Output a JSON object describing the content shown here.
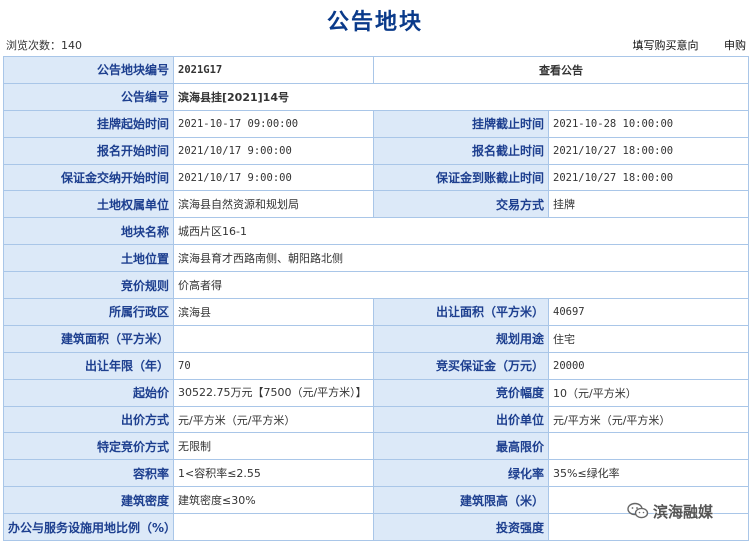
{
  "page": {
    "title": "公告地块",
    "view_count_label": "浏览次数：140",
    "links": [
      "填写购买意向",
      "申购"
    ]
  },
  "table": {
    "parcel_code_label": "公告地块编号",
    "parcel_code": "2021G17",
    "view_notice": "查看公告",
    "notice_no_label": "公告编号",
    "notice_no": "滨海县挂[2021]14号",
    "list_start_label": "挂牌起始时间",
    "list_start": "2021-10-17 09:00:00",
    "list_end_label": "挂牌截止时间",
    "list_end": "2021-10-28 10:00:00",
    "reg_start_label": "报名开始时间",
    "reg_start": "2021/10/17 9:00:00",
    "reg_end_label": "报名截止时间",
    "reg_end": "2021/10/27 18:00:00",
    "deposit_start_label": "保证金交纳开始时间",
    "deposit_start": "2021/10/17 9:00:00",
    "deposit_end_label": "保证金到账截止时间",
    "deposit_end": "2021/10/27 18:00:00",
    "owner_label": "土地权属单位",
    "owner": "滨海县自然资源和规划局",
    "trade_method_label": "交易方式",
    "trade_method": "挂牌",
    "parcel_name_label": "地块名称",
    "parcel_name": "城西片区16-1",
    "location_label": "土地位置",
    "location": "滨海县育才西路南侧、朝阳路北侧",
    "bid_rule_label": "竞价规则",
    "bid_rule": "价高者得",
    "district_label": "所属行政区",
    "district": "滨海县",
    "area_label": "出让面积（平方米）",
    "area": "40697",
    "building_area_label": "建筑面积（平方米）",
    "building_area": "",
    "use_label": "规划用途",
    "use": "住宅",
    "term_label": "出让年限（年）",
    "term": "70",
    "bid_deposit_label": "竞买保证金（万元）",
    "bid_deposit": "20000",
    "start_price_label": "起始价",
    "start_price": "30522.75万元【7500（元/平方米）】",
    "increment_label": "竞价幅度",
    "increment": "10（元/平方米）",
    "bid_mode_label": "出价方式",
    "bid_mode": "元/平方米（元/平方米）",
    "bid_unit_label": "出价单位",
    "bid_unit": "元/平方米（元/平方米）",
    "special_mode_label": "特定竞价方式",
    "special_mode": "无限制",
    "max_price_label": "最高限价",
    "max_price": "",
    "far_label": "容积率",
    "far": "1<容积率≤2.55",
    "green_label": "绿化率",
    "green": "35%≤绿化率",
    "density_label": "建筑密度",
    "density": "建筑密度≤30%",
    "height_label": "建筑限高（米）",
    "height": "",
    "office_ratio_label": "办公与服务设施用地比例（%）",
    "office_ratio": "",
    "invest_label": "投资强度",
    "invest": ""
  },
  "watermark": {
    "icon": "wechat-icon",
    "text": "滨海融媒"
  }
}
